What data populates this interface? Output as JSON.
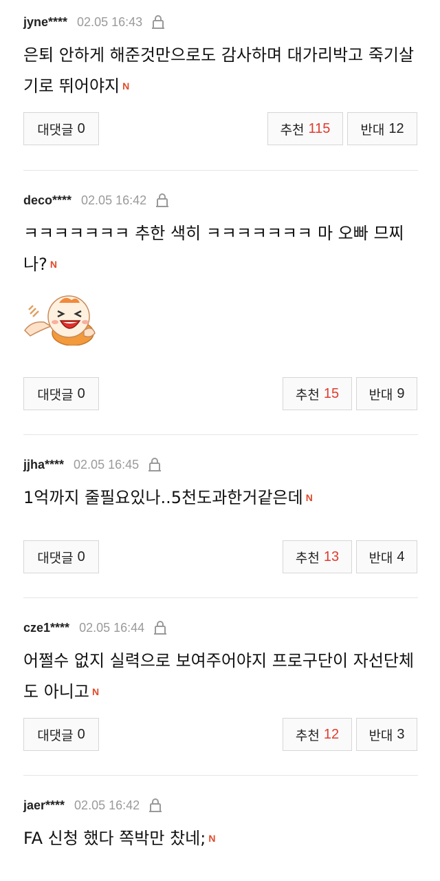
{
  "icons": {
    "report": "lock-icon",
    "new": "new-badge"
  },
  "colors": {
    "recommend_number": "#e03a2e",
    "new_badge": "#e04a2a",
    "divider": "#e5e5e5"
  },
  "comments": [
    {
      "author": "jyne****",
      "date": "02.05 16:43",
      "text": "은퇴 안하게 해준것만으로도 감사하며 대가리박고 죽기살기로 뛰어야지",
      "new_badge": "N",
      "reply_label": "대댓글",
      "reply_count": "0",
      "recommend_label": "추천",
      "recommend_count": "115",
      "oppose_label": "반대",
      "oppose_count": "12"
    },
    {
      "author": "deco****",
      "date": "02.05 16:42",
      "text": "ㅋㅋㅋㅋㅋㅋㅋ 추한 색히 ㅋㅋㅋㅋㅋㅋㅋ 마 오빠 므찌나?",
      "new_badge": "N",
      "sticker": "laughing-emoticon",
      "reply_label": "대댓글",
      "reply_count": "0",
      "recommend_label": "추천",
      "recommend_count": "15",
      "oppose_label": "반대",
      "oppose_count": "9"
    },
    {
      "author": "jjha****",
      "date": "02.05 16:45",
      "text": "1억까지 줄필요있나..5천도과한거같은데",
      "new_badge": "N",
      "reply_label": "대댓글",
      "reply_count": "0",
      "recommend_label": "추천",
      "recommend_count": "13",
      "oppose_label": "반대",
      "oppose_count": "4"
    },
    {
      "author": "cze1****",
      "date": "02.05 16:44",
      "text": "어쩔수 없지 실력으로 보여주어야지 프로구단이 자선단체도 아니고",
      "new_badge": "N",
      "reply_label": "대댓글",
      "reply_count": "0",
      "recommend_label": "추천",
      "recommend_count": "12",
      "oppose_label": "반대",
      "oppose_count": "3"
    },
    {
      "author": "jaer****",
      "date": "02.05 16:42",
      "text": "FA 신청 했다 쪽박만 찼네;",
      "new_badge": "N"
    }
  ]
}
